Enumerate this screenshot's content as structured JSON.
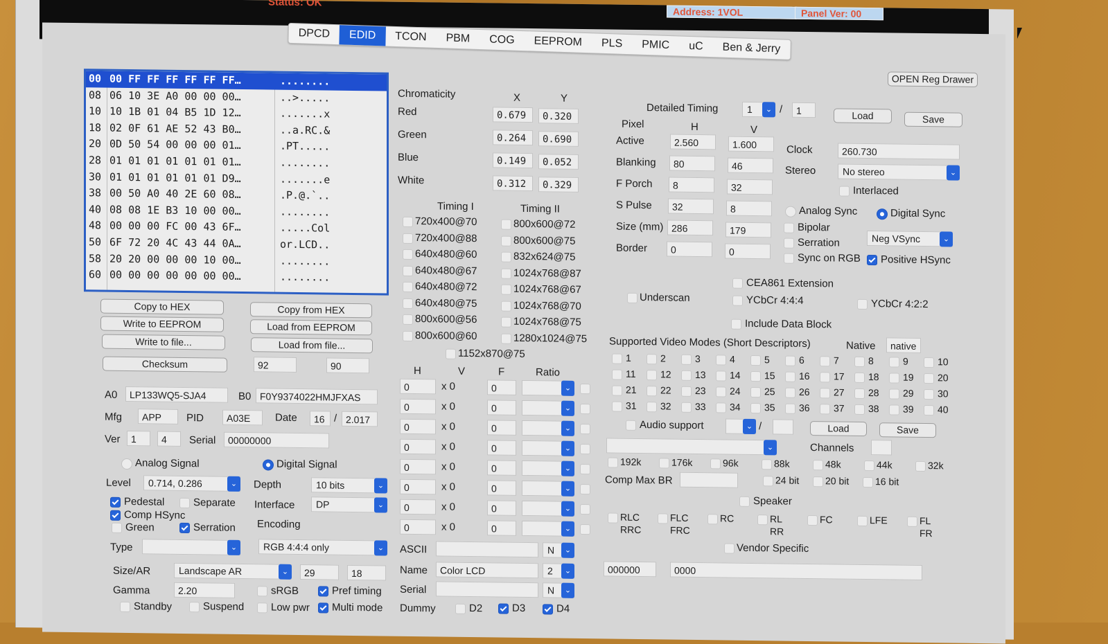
{
  "statusbar": {
    "status": "Status: OK",
    "address": "Address: 1VOL",
    "panel_ver": "Panel Ver: 00"
  },
  "tabs": [
    {
      "label": "DPCD",
      "active": false
    },
    {
      "label": "EDID",
      "active": true
    },
    {
      "label": "TCON",
      "active": false
    },
    {
      "label": "PBM",
      "active": false
    },
    {
      "label": "COG",
      "active": false
    },
    {
      "label": "EEPROM",
      "active": false
    },
    {
      "label": "PLS",
      "active": false
    },
    {
      "label": "PMIC",
      "active": false
    },
    {
      "label": "uC",
      "active": false
    },
    {
      "label": "Ben & Jerry",
      "active": false
    }
  ],
  "open_reg_drawer": "OPEN Reg Drawer",
  "hex": {
    "rows": [
      {
        "off": "00",
        "bytes": "00 FF FF FF FF FF FF…",
        "ascii": "........"
      },
      {
        "off": "08",
        "bytes": "06 10 3E A0 00 00 00…",
        "ascii": "..>....."
      },
      {
        "off": "10",
        "bytes": "10 1B 01 04 B5 1D 12…",
        "ascii": ".......x"
      },
      {
        "off": "18",
        "bytes": "02 0F 61 AE 52 43 B0…",
        "ascii": "..a.RC.&"
      },
      {
        "off": "20",
        "bytes": "0D 50 54 00 00 00 01…",
        "ascii": ".PT....."
      },
      {
        "off": "28",
        "bytes": "01 01 01 01 01 01 01…",
        "ascii": "........"
      },
      {
        "off": "30",
        "bytes": "01 01 01 01 01 01 D9…",
        "ascii": ".......e"
      },
      {
        "off": "38",
        "bytes": "00 50 A0 40 2E 60 08…",
        "ascii": ".P.@.`.."
      },
      {
        "off": "40",
        "bytes": "08 08 1E B3 10 00 00…",
        "ascii": "........"
      },
      {
        "off": "48",
        "bytes": "00 00 00 FC 00 43 6F…",
        "ascii": ".....Col"
      },
      {
        "off": "50",
        "bytes": "6F 72 20 4C 43 44 0A…",
        "ascii": "or.LCD.."
      },
      {
        "off": "58",
        "bytes": "20 20 00 00 00 10 00…",
        "ascii": "........"
      },
      {
        "off": "60",
        "bytes": "00 00 00 00 00 00 00…",
        "ascii": "........"
      }
    ]
  },
  "actions": {
    "copy_to_hex": "Copy to HEX",
    "copy_from_hex": "Copy from HEX",
    "write_eeprom": "Write to EEPROM",
    "load_eeprom": "Load from EEPROM",
    "write_file": "Write to file...",
    "load_file": "Load from file...",
    "checksum": "Checksum",
    "checksum_a": "92",
    "checksum_b": "90"
  },
  "ident": {
    "a0_label": "A0",
    "a0": "LP133WQ5-SJA4",
    "b0_label": "B0",
    "b0": "F0Y9374022HMJFXAS",
    "mfg_label": "Mfg",
    "mfg": "APP",
    "pid_label": "PID",
    "pid": "A03E",
    "date_label": "Date",
    "date_week": "16",
    "date_year": "2.017",
    "ver_label": "Ver",
    "ver_major": "1",
    "ver_minor": "4",
    "serial_label": "Serial",
    "serial": "00000000"
  },
  "signal": {
    "analog": "Analog Signal",
    "digital": "Digital Signal",
    "digital_selected": true,
    "level_label": "Level",
    "level": "0.714, 0.286",
    "pedestal": "Pedestal",
    "pedestal_on": true,
    "separate": "Separate",
    "separate_on": false,
    "comp_hsync": "Comp HSync",
    "comp_hsync_on": true,
    "green": "Green",
    "green_on": false,
    "serration": "Serration",
    "serration_on": true,
    "type_label": "Type",
    "type": "",
    "depth_label": "Depth",
    "depth": "10 bits",
    "interface_label": "Interface",
    "interface": "DP",
    "encoding_label": "Encoding",
    "encoding": "RGB 4:4:4 only",
    "size_ar_label": "Size/AR",
    "size_ar": "Landscape AR",
    "size_h": "29",
    "size_v": "18",
    "gamma_label": "Gamma",
    "gamma": "2.20",
    "srgb": "sRGB",
    "srgb_on": false,
    "pref_timing": "Pref timing",
    "pref_timing_on": true,
    "standby": "Standby",
    "suspend": "Suspend",
    "low_pwr": "Low pwr",
    "multi_mode": "Multi mode",
    "multi_mode_on": true
  },
  "chroma": {
    "title": "Chromaticity",
    "x_label": "X",
    "y_label": "Y",
    "rows": [
      {
        "name": "Red",
        "x": "0.679",
        "y": "0.320"
      },
      {
        "name": "Green",
        "x": "0.264",
        "y": "0.690"
      },
      {
        "name": "Blue",
        "x": "0.149",
        "y": "0.052"
      },
      {
        "name": "White",
        "x": "0.312",
        "y": "0.329"
      }
    ]
  },
  "timings": {
    "t1_label": "Timing I",
    "t2_label": "Timing II",
    "t1": [
      "720x400@70",
      "720x400@88",
      "640x480@60",
      "640x480@67",
      "640x480@72",
      "640x480@75",
      "800x600@56",
      "800x600@60"
    ],
    "t2": [
      "800x600@72",
      "800x600@75",
      "832x624@75",
      "1024x768@87",
      "1024x768@67",
      "1024x768@70",
      "1024x768@75",
      "1280x1024@75"
    ],
    "extra": "1152x870@75"
  },
  "std_timings": {
    "h_label": "H",
    "v_label": "V",
    "f_label": "F",
    "ratio_label": "Ratio",
    "rows": [
      {
        "h": "0",
        "v": "x 0",
        "f": "0"
      },
      {
        "h": "0",
        "v": "x 0",
        "f": "0"
      },
      {
        "h": "0",
        "v": "x 0",
        "f": "0"
      },
      {
        "h": "0",
        "v": "x 0",
        "f": "0"
      },
      {
        "h": "0",
        "v": "x 0",
        "f": "0"
      },
      {
        "h": "0",
        "v": "x 0",
        "f": "0"
      },
      {
        "h": "0",
        "v": "x 0",
        "f": "0"
      },
      {
        "h": "0",
        "v": "x 0",
        "f": "0"
      }
    ]
  },
  "descriptors": {
    "ascii_label": "ASCII",
    "ascii": "",
    "ascii_sel": "N",
    "name_label": "Name",
    "name": "Color LCD",
    "name_sel": "2",
    "serial_label": "Serial",
    "serial": "",
    "serial_sel": "N",
    "dummy_label": "Dummy",
    "d2": "D2",
    "d2_on": false,
    "d3": "D3",
    "d3_on": true,
    "d4": "D4",
    "d4_on": true
  },
  "detailed": {
    "title": "Detailed Timing",
    "index": "1",
    "total": "1",
    "load": "Load",
    "save": "Save",
    "pixel_label": "Pixel",
    "h_label": "H",
    "v_label": "V",
    "rows": [
      {
        "name": "Active",
        "h": "2.560",
        "v": "1.600"
      },
      {
        "name": "Blanking",
        "h": "80",
        "v": "46"
      },
      {
        "name": "F Porch",
        "h": "8",
        "v": "32"
      },
      {
        "name": "S Pulse",
        "h": "32",
        "v": "8"
      },
      {
        "name": "Size (mm)",
        "h": "286",
        "v": "179"
      },
      {
        "name": "Border",
        "h": "0",
        "v": "0"
      }
    ],
    "clock_label": "Clock",
    "clock": "260.730",
    "stereo_label": "Stereo",
    "stereo": "No stereo",
    "interlaced": "Interlaced",
    "analog_sync": "Analog Sync",
    "digital_sync": "Digital Sync",
    "bipolar": "Bipolar",
    "serration": "Serration",
    "sync_on_rgb": "Sync on RGB",
    "vsync": "Neg VSync",
    "positive_hsync": "Positive HSync",
    "positive_hsync_on": true
  },
  "cea": {
    "extension": "CEA861 Extension",
    "underscan": "Underscan",
    "ycbcr444": "YCbCr 4:4:4",
    "ycbcr422": "YCbCr 4:2:2",
    "include_data_block": "Include Data Block",
    "svd_title": "Supported Video Modes (Short Descriptors)",
    "native_label": "Native",
    "native": "native",
    "modes": [
      "1",
      "2",
      "3",
      "4",
      "5",
      "6",
      "7",
      "8",
      "9",
      "10",
      "11",
      "12",
      "13",
      "14",
      "15",
      "16",
      "17",
      "18",
      "19",
      "20",
      "21",
      "22",
      "23",
      "24",
      "25",
      "26",
      "27",
      "28",
      "29",
      "30",
      "31",
      "32",
      "33",
      "34",
      "35",
      "36",
      "37",
      "38",
      "39",
      "40"
    ],
    "audio_support": "Audio support",
    "audio_load": "Load",
    "audio_save": "Save",
    "channels_label": "Channels",
    "rates": [
      "192k",
      "176k",
      "96k",
      "88k",
      "48k",
      "44k",
      "32k"
    ],
    "comp_max_br": "Comp Max BR",
    "bits": [
      "24 bit",
      "20 bit",
      "16 bit"
    ],
    "speaker": "Speaker",
    "speakers": [
      [
        "RLC",
        "RRC"
      ],
      [
        "FLC",
        "FRC"
      ],
      [
        "RC",
        ""
      ],
      [
        "RL",
        "RR"
      ],
      [
        "FC",
        ""
      ],
      [
        "LFE",
        ""
      ],
      [
        "FL",
        "FR"
      ]
    ],
    "vendor_specific": "Vendor Specific",
    "vendor_id": "000000",
    "vendor_data": "0000"
  }
}
